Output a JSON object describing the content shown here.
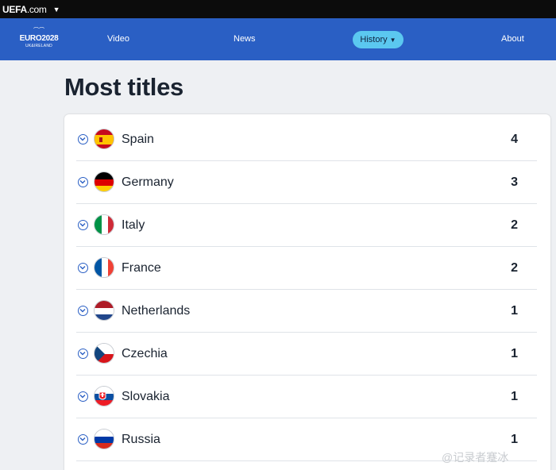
{
  "topbar": {
    "site": "UEFA",
    "domain": ".com"
  },
  "brand": {
    "name": "EURO2028",
    "subtitle": "UK&IRELAND"
  },
  "nav": {
    "video": "Video",
    "news": "News",
    "history": "History",
    "about": "About"
  },
  "page_title": "Most titles",
  "countries": [
    {
      "name": "Spain",
      "titles": "4",
      "flag": "spain"
    },
    {
      "name": "Germany",
      "titles": "3",
      "flag": "germany"
    },
    {
      "name": "Italy",
      "titles": "2",
      "flag": "italy"
    },
    {
      "name": "France",
      "titles": "2",
      "flag": "france"
    },
    {
      "name": "Netherlands",
      "titles": "1",
      "flag": "netherlands"
    },
    {
      "name": "Czechia",
      "titles": "1",
      "flag": "czechia"
    },
    {
      "name": "Slovakia",
      "titles": "1",
      "flag": "slovakia"
    },
    {
      "name": "Russia",
      "titles": "1",
      "flag": "russia"
    }
  ],
  "watermark": "@记录者蹇冰",
  "colors": {
    "nav_bg": "#2a5fc4",
    "pill_bg": "#5bc8f0",
    "page_bg": "#eef0f3"
  }
}
